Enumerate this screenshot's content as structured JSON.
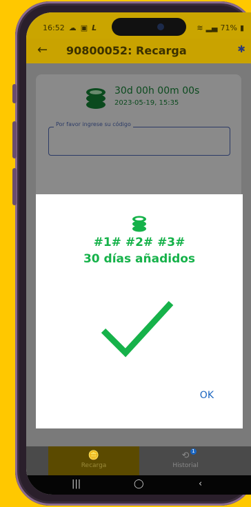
{
  "status_bar": {
    "time": "16:52",
    "left_icons": [
      "cloud-icon",
      "image-icon",
      "l-icon"
    ],
    "battery": "71%",
    "right_icons": [
      "wifi-icon",
      "signal-icon",
      "battery-icon"
    ]
  },
  "app_bar": {
    "title": "90800052: Recarga",
    "back_icon": "arrow-left-icon",
    "bluetooth_icon": "bluetooth-icon"
  },
  "card": {
    "remaining_time": "30d 00h 00m 00s",
    "date": "2023-05-19, 15:35",
    "code_label": "Por favor ingrese su código"
  },
  "dialog": {
    "codes": "#1# #2# #3#",
    "message": "30 días añadidos",
    "ok_label": "OK",
    "accent": "#16B24A"
  },
  "bottom_nav": {
    "items": [
      {
        "label": "Recarga",
        "icon": "coins-icon",
        "selected": true
      },
      {
        "label": "Historial",
        "icon": "history-icon",
        "badge": "1"
      }
    ]
  },
  "system_nav": [
    "recents-icon",
    "home-icon",
    "back-icon"
  ],
  "colors": {
    "background": "#FFC800",
    "app_bar": "#C9A300",
    "success": "#16B24A",
    "link": "#1A65C0"
  }
}
